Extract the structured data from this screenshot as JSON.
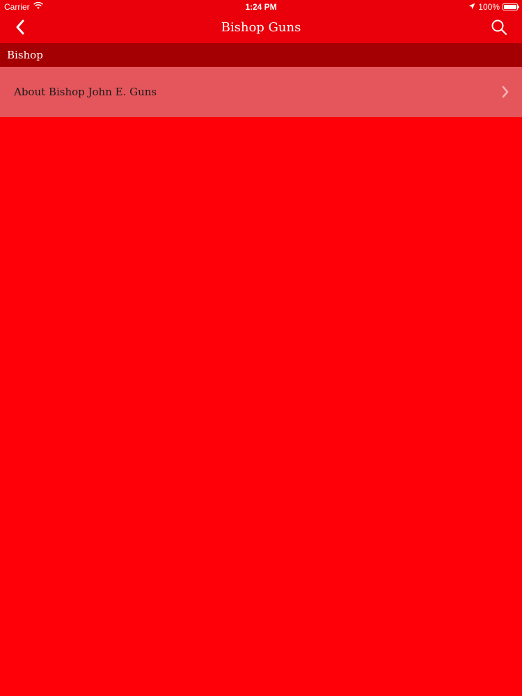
{
  "status_bar": {
    "carrier": "Carrier",
    "time": "1:24 PM",
    "battery": "100%",
    "icons": [
      "wifi-icon",
      "location-arrow-icon",
      "battery-icon"
    ]
  },
  "nav": {
    "title": "Bishop Guns",
    "back_icon": "chevron-left-icon",
    "search_icon": "search-icon"
  },
  "section": {
    "title": "Bishop"
  },
  "list": {
    "items": [
      {
        "label": "About Bishop John E. Guns",
        "icon": "chevron-right-icon"
      }
    ]
  },
  "colors": {
    "nav_background": "#e9000a",
    "section_header": "#a40003",
    "list_item_background": "#e5565c",
    "page_background": "#ff0008",
    "text_light": "#ffffff",
    "text_dark": "#1a1a1a"
  }
}
